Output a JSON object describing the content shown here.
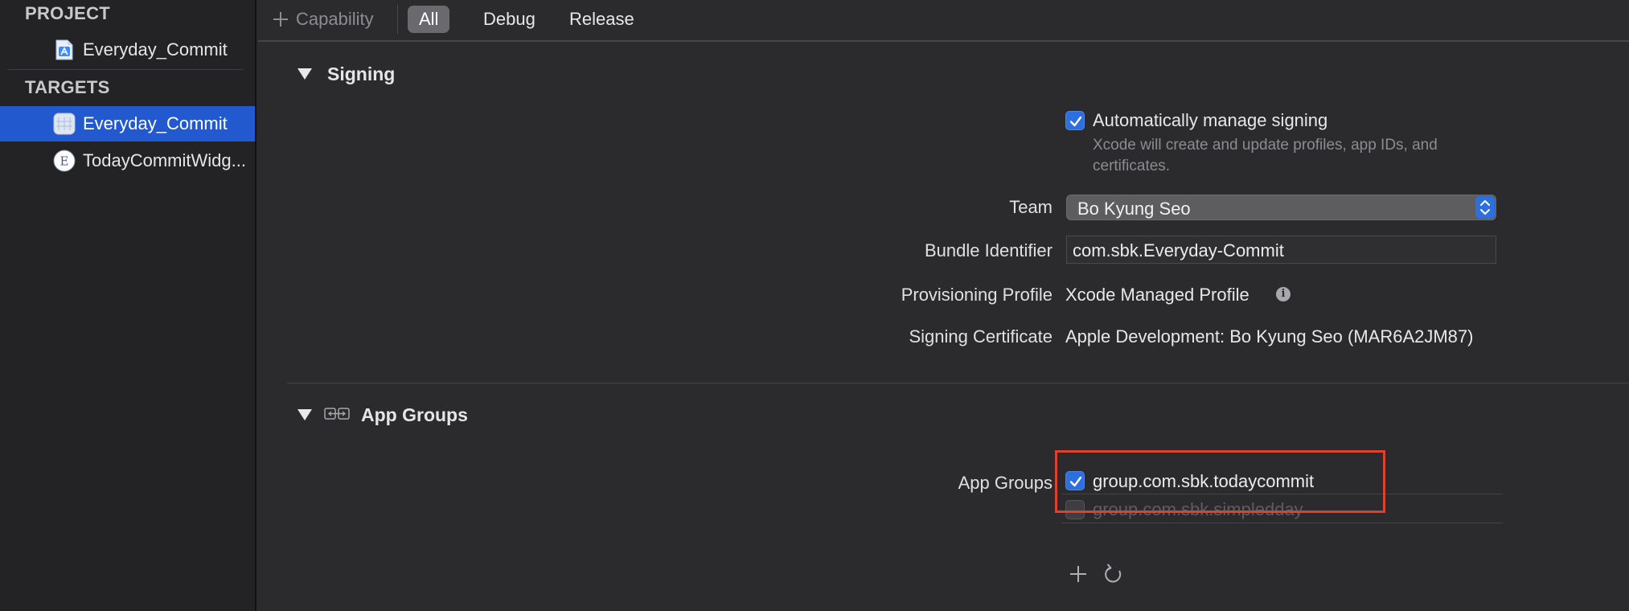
{
  "sidebar": {
    "project_header": "PROJECT",
    "project_item": "Everyday_Commit",
    "targets_header": "TARGETS",
    "targets": [
      {
        "label": "Everyday_Commit",
        "selected": true,
        "icon": "app-target-icon"
      },
      {
        "label": "TodayCommitWidg...",
        "selected": false,
        "icon": "extension-target-icon"
      }
    ]
  },
  "toolbar": {
    "capability_label": "Capability",
    "filters": [
      "All",
      "Debug",
      "Release"
    ],
    "active_filter": "All"
  },
  "signing": {
    "title": "Signing",
    "auto_manage_label": "Automatically manage signing",
    "auto_manage_checked": true,
    "auto_manage_hint": "Xcode will create and update profiles, app IDs, and certificates.",
    "team_label": "Team",
    "team_value": "Bo Kyung Seo",
    "bundle_label": "Bundle Identifier",
    "bundle_value": "com.sbk.Everyday-Commit",
    "profile_label": "Provisioning Profile",
    "profile_value": "Xcode Managed Profile",
    "certificate_label": "Signing Certificate",
    "certificate_value": "Apple Development: Bo Kyung Seo (MAR6A2JM87)"
  },
  "app_groups": {
    "title": "App Groups",
    "label": "App Groups",
    "groups": [
      {
        "id": "group.com.sbk.todaycommit",
        "checked": true
      },
      {
        "id": "group.com.sbk.simpledday",
        "checked": false
      }
    ]
  },
  "colors": {
    "accent": "#2e6fe0",
    "selection": "#2259cf",
    "highlight_box": "#e0402e",
    "background": "#2b2b2d",
    "sidebar": "#232325"
  }
}
